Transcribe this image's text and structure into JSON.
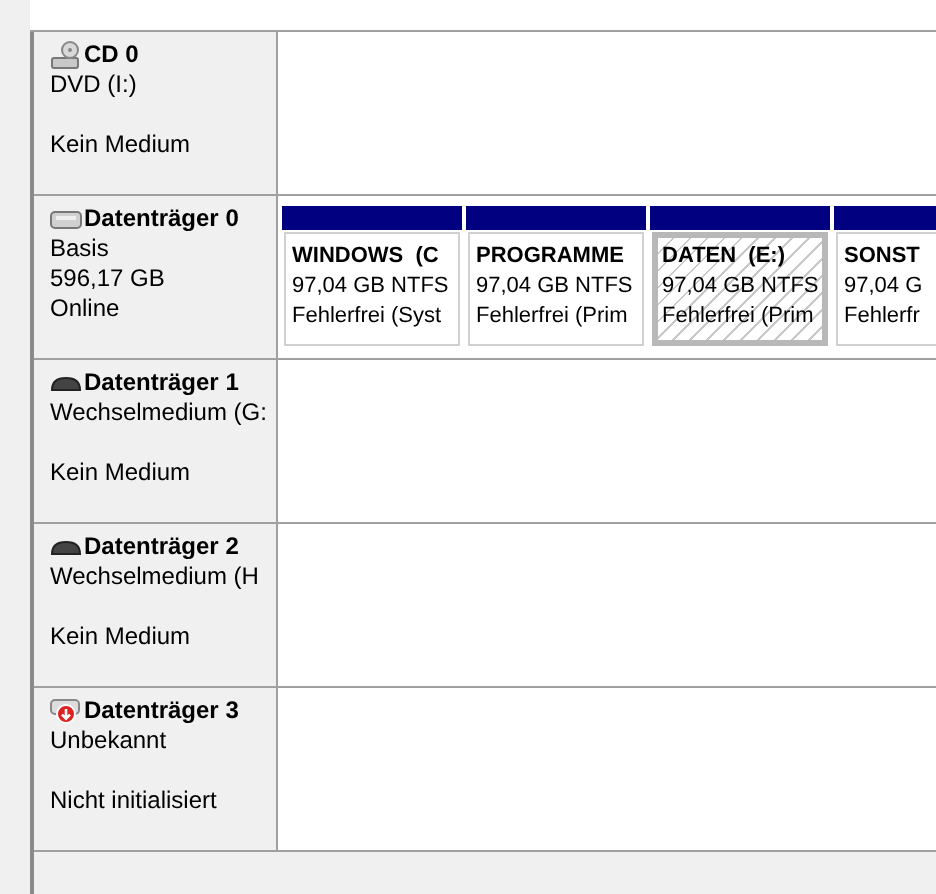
{
  "disks": [
    {
      "kind": "cd",
      "name": "CD 0",
      "info": "DVD (I:)",
      "status": "Kein Medium"
    },
    {
      "kind": "hdd",
      "name": "Datenträger 0",
      "info": "Basis",
      "size": "596,17 GB",
      "status": "Online",
      "partitions": [
        {
          "name": "WINDOWS  (C",
          "size": "97,04 GB NTFS",
          "status": "Fehlerfrei (Syst",
          "selected": false
        },
        {
          "name": "PROGRAMME",
          "size": "97,04 GB NTFS",
          "status": "Fehlerfrei (Prim",
          "selected": false
        },
        {
          "name": "DATEN  (E:)",
          "size": "97,04 GB NTFS",
          "status": "Fehlerfrei (Prim",
          "selected": true
        },
        {
          "name": "SONST",
          "size": "97,04 G",
          "status": "Fehlerfr",
          "selected": false
        }
      ]
    },
    {
      "kind": "removable",
      "name": "Datenträger 1",
      "info": "Wechselmedium (G:",
      "status": "Kein Medium"
    },
    {
      "kind": "removable",
      "name": "Datenträger 2",
      "info": "Wechselmedium (H",
      "status": "Kein Medium"
    },
    {
      "kind": "unknown",
      "name": "Datenträger 3",
      "info": "Unbekannt",
      "status": "Nicht initialisiert"
    }
  ]
}
